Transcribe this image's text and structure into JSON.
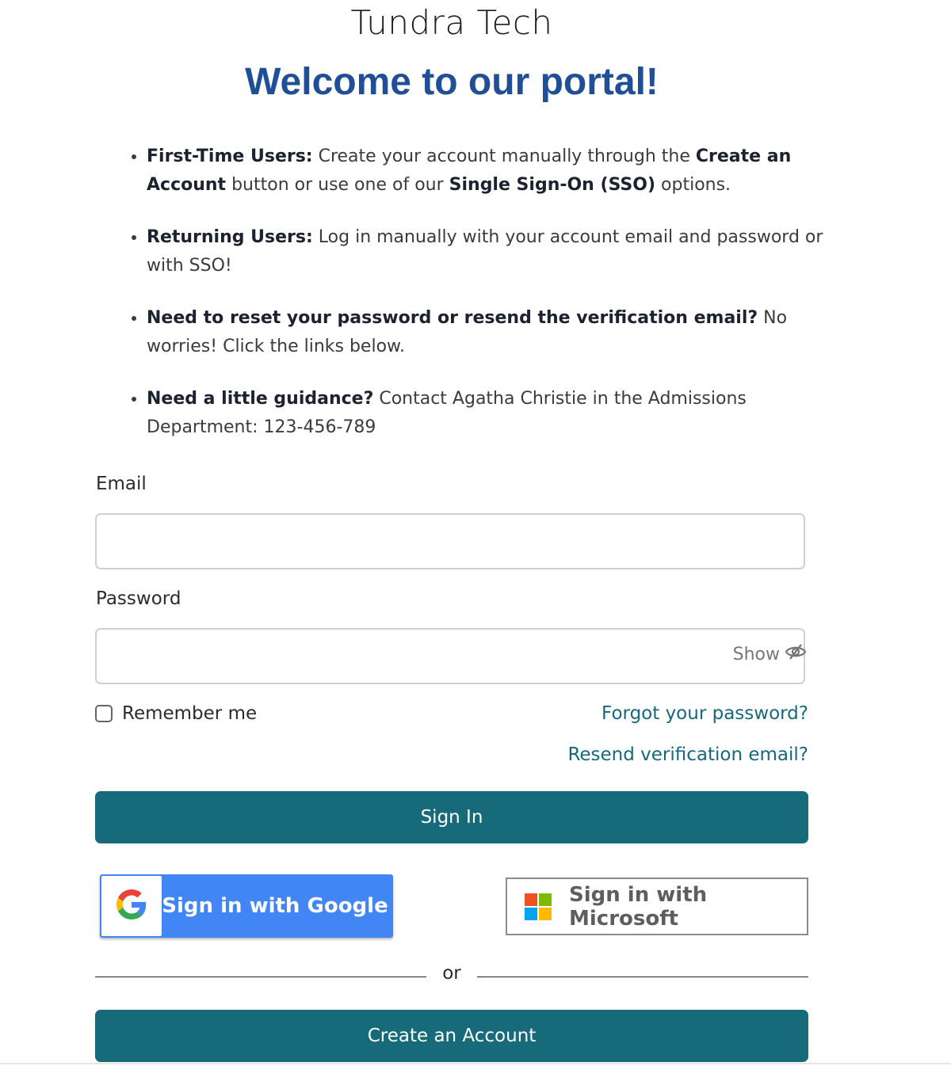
{
  "header": {
    "org_name": "Tundra Tech",
    "welcome": "Welcome to our portal!"
  },
  "info": [
    {
      "b1": "First-Time Users:",
      "t1": " Create your account manually through the ",
      "b2": "Create an Account",
      "t2": " button or use one of our ",
      "b3": "Single Sign-On (SSO)",
      "t3": " options."
    },
    {
      "b1": "Returning Users:",
      "t1": " Log in manually with your account email and password or with SSO!"
    },
    {
      "b1": "Need to reset your password or resend the verification email?",
      "t1": " No worries! Click the links below."
    },
    {
      "b1": "Need a little guidance?",
      "t1": " Contact Agatha Christie in the Admissions Department: 123-456-789"
    }
  ],
  "form": {
    "email_label": "Email",
    "email_value": "",
    "password_label": "Password",
    "password_value": "",
    "show_label": "Show",
    "remember_label": "Remember me",
    "remember_checked": false,
    "forgot_link": "Forgot your password?",
    "resend_link": "Resend verification email?",
    "sign_in_label": "Sign In"
  },
  "sso": {
    "google_label": "Sign in with Google",
    "microsoft_label": "Sign in with Microsoft"
  },
  "divider_text": "or",
  "create_account_label": "Create an Account",
  "colors": {
    "title_blue": "#1f4f96",
    "primary_teal": "#166a79",
    "link_teal": "#16697a",
    "google_blue": "#4285f4"
  },
  "icons": {
    "show_password": "eye-slash-icon",
    "google": "google-logo-icon",
    "microsoft": "microsoft-logo-icon"
  }
}
